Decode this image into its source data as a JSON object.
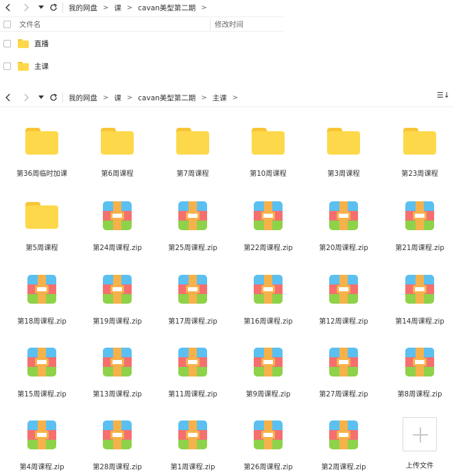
{
  "top_pane": {
    "breadcrumb": [
      "我的网盘",
      "课",
      "cavan美型第二期"
    ],
    "columns": {
      "name": "文件名",
      "modified": "修改时间"
    },
    "rows": [
      {
        "name": "直播"
      },
      {
        "name": "主课"
      }
    ]
  },
  "bottom_pane": {
    "breadcrumb": [
      "我的网盘",
      "课",
      "cavan美型第二期",
      "主课"
    ],
    "view_toggle": "☰↓",
    "items": [
      {
        "name": "第36周临时加课",
        "type": "folder"
      },
      {
        "name": "第6周课程",
        "type": "folder"
      },
      {
        "name": "第7周课程",
        "type": "folder"
      },
      {
        "name": "第10周课程",
        "type": "folder"
      },
      {
        "name": "第3周课程",
        "type": "folder"
      },
      {
        "name": "第23周课程",
        "type": "folder"
      },
      {
        "name": "第5周课程",
        "type": "folder"
      },
      {
        "name": "第24周课程.zip",
        "type": "zip"
      },
      {
        "name": "第25周课程.zip",
        "type": "zip"
      },
      {
        "name": "第22周课程.zip",
        "type": "zip"
      },
      {
        "name": "第20周课程.zip",
        "type": "zip"
      },
      {
        "name": "第21周课程.zip",
        "type": "zip"
      },
      {
        "name": "第18周课程.zip",
        "type": "zip"
      },
      {
        "name": "第19周课程.zip",
        "type": "zip"
      },
      {
        "name": "第17周课程.zip",
        "type": "zip"
      },
      {
        "name": "第16周课程.zip",
        "type": "zip"
      },
      {
        "name": "第12周课程.zip",
        "type": "zip"
      },
      {
        "name": "第14周课程.zip",
        "type": "zip"
      },
      {
        "name": "第15周课程.zip",
        "type": "zip"
      },
      {
        "name": "第13周课程.zip",
        "type": "zip"
      },
      {
        "name": "第11周课程.zip",
        "type": "zip"
      },
      {
        "name": "第9周课程.zip",
        "type": "zip"
      },
      {
        "name": "第27周课程.zip",
        "type": "zip"
      },
      {
        "name": "第8周课程.zip",
        "type": "zip"
      },
      {
        "name": "第4周课程.zip",
        "type": "zip"
      },
      {
        "name": "第28周课程.zip",
        "type": "zip"
      },
      {
        "name": "第1周课程.zip",
        "type": "zip"
      },
      {
        "name": "第26周课程.zip",
        "type": "zip"
      },
      {
        "name": "第2周课程.zip",
        "type": "zip"
      },
      {
        "name": "上传文件",
        "type": "upload"
      }
    ]
  },
  "icons": {
    "back": "chevron-left-icon",
    "forward": "chevron-right-icon",
    "history": "caret-down-icon",
    "refresh": "refresh-icon"
  },
  "colors": {
    "folder": "#fdd84a",
    "zip_top": "#5bc0f0",
    "zip_mid": "#f56f6f",
    "zip_bottom": "#8ed24a",
    "zip_strap": "#f6b24a"
  }
}
